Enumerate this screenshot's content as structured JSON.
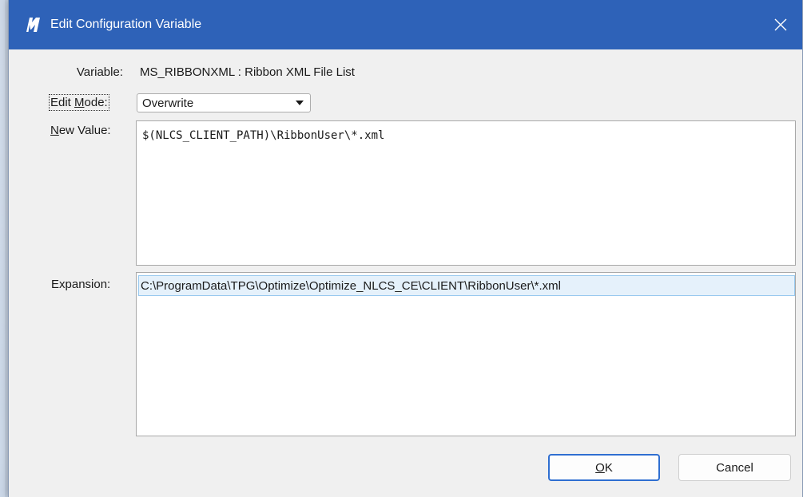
{
  "dialog": {
    "title": "Edit Configuration Variable",
    "close_icon": "close-icon",
    "app_icon": "microstation-icon"
  },
  "variable": {
    "label": "Variable:",
    "value": "MS_RIBBONXML : Ribbon XML File List"
  },
  "edit_mode": {
    "label_prefix": "Edit ",
    "label_accel": "M",
    "label_suffix": "ode:",
    "selected": "Overwrite"
  },
  "new_value": {
    "label_accel": "N",
    "label_suffix": "ew Value:",
    "value": "$(NLCS_CLIENT_PATH)\\RibbonUser\\*.xml"
  },
  "expansion": {
    "label": "Expansion:",
    "lines": [
      "C:\\ProgramData\\TPG\\Optimize\\Optimize_NLCS_CE\\CLIENT\\RibbonUser\\*.xml"
    ]
  },
  "buttons": {
    "ok_accel": "O",
    "ok_suffix": "K",
    "cancel": "Cancel"
  },
  "colors": {
    "titlebar": "#2e62b8",
    "selection": "#e5f1fb",
    "default_button_border": "#2f6fd1"
  }
}
